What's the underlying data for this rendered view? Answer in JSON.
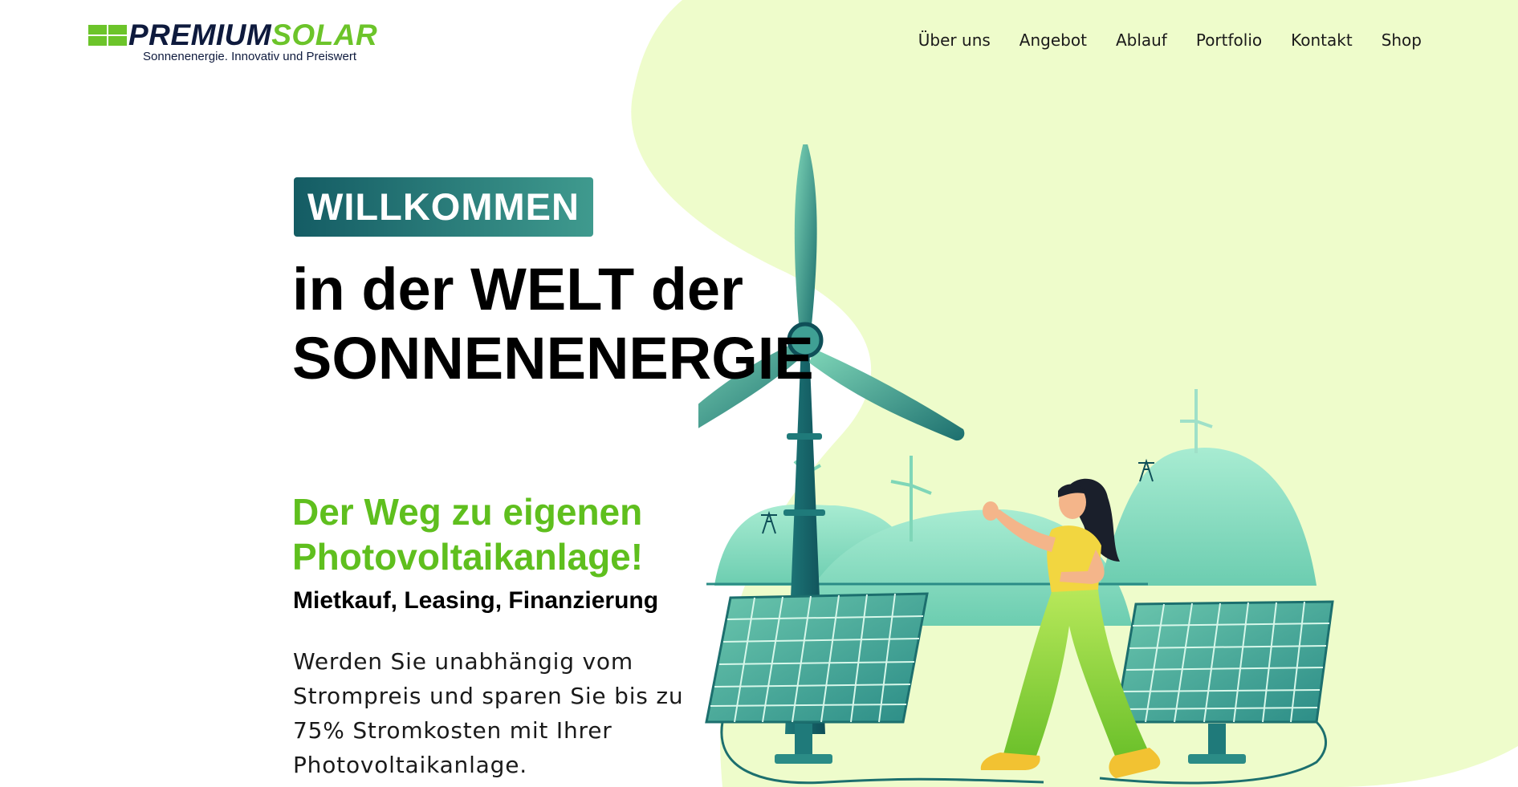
{
  "header": {
    "logo": {
      "brand_part1": "PREMIUM",
      "brand_part2": "SOLAR",
      "tagline": "Sonnenenergie. Innovativ und Preiswert"
    },
    "nav": [
      {
        "label": "Über uns"
      },
      {
        "label": "Angebot"
      },
      {
        "label": "Ablauf"
      },
      {
        "label": "Portfolio"
      },
      {
        "label": "Kontakt"
      },
      {
        "label": "Shop"
      }
    ]
  },
  "hero": {
    "badge": "WILLKOMMEN",
    "title_line1": "in der WELT der",
    "title_line2": "SONNENENERGIE",
    "subheadline_line1": "Der Weg zu eigenen",
    "subheadline_line2": "Photovoltaikanlage!",
    "financing": "Mietkauf, Leasing, Finanzierung",
    "description": "Werden Sie unabhängig vom Strompreis und sparen Sie bis zu 75% Stromkosten mit Ihrer Photovoltaikanlage."
  },
  "colors": {
    "brand_green": "#6cc42a",
    "brand_navy": "#0e1a3d",
    "teal_dark": "#145c64",
    "teal_light": "#3f9a8e",
    "blob_background": "#eefccb",
    "headline_green": "#5fbf1e"
  },
  "illustration": {
    "name": "wind-turbine-solar-panels-woman-illustration"
  }
}
